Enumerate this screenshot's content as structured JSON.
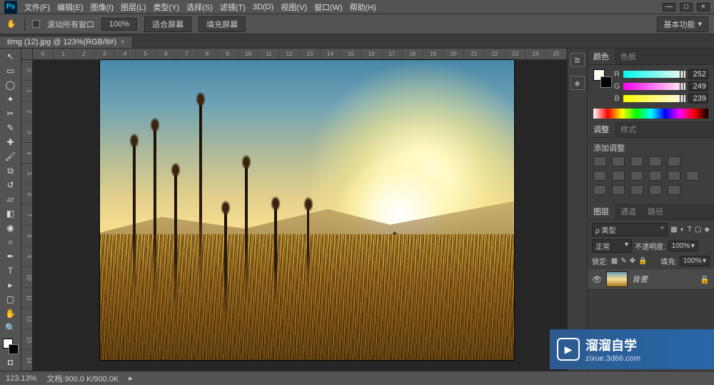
{
  "menu": {
    "items": [
      "文件(F)",
      "编辑(E)",
      "图像(I)",
      "图层(L)",
      "类型(Y)",
      "选择(S)",
      "滤镜(T)",
      "3D(D)",
      "视图(V)",
      "窗口(W)",
      "帮助(H)"
    ]
  },
  "optbar": {
    "scroll_all": "滚动所有窗口",
    "zoom": "100%",
    "fit": "适合屏幕",
    "fill": "填充屏幕",
    "workspace": "基本功能"
  },
  "doc": {
    "tab_title": "timg (12).jpg @ 123%(RGB/8#)"
  },
  "color": {
    "label": "颜色",
    "swatch_label": "色板",
    "r": "R",
    "g": "G",
    "b": "B",
    "rv": "252",
    "gv": "249",
    "bv": "239"
  },
  "adjust": {
    "tab": "调整",
    "tab2": "样式",
    "title": "添加调整"
  },
  "layers": {
    "tab_layers": "图层",
    "tab_channels": "通道",
    "tab_paths": "路径",
    "kind": "ρ 类型",
    "blend": "正常",
    "opacity_lbl": "不透明度:",
    "opacity": "100%",
    "lock_lbl": "锁定:",
    "fill_lbl": "填充:",
    "fill": "100%",
    "bg_name": "背景"
  },
  "status": {
    "zoom": "123.13%",
    "doc": "文档:900.0 K/900.0K"
  },
  "wm": {
    "big": "溜溜自学",
    "small": "zixue.3d66.com"
  },
  "ruler_h": [
    "0",
    "1",
    "2",
    "3",
    "4",
    "5",
    "6",
    "7",
    "8",
    "9",
    "10",
    "11",
    "12",
    "13",
    "14",
    "15",
    "16",
    "17",
    "18",
    "19",
    "20",
    "21",
    "22",
    "23",
    "24",
    "25"
  ],
  "ruler_v": [
    "0",
    "1",
    "2",
    "3",
    "4",
    "5",
    "6",
    "7",
    "8",
    "9",
    "10",
    "11",
    "12",
    "13",
    "14"
  ]
}
